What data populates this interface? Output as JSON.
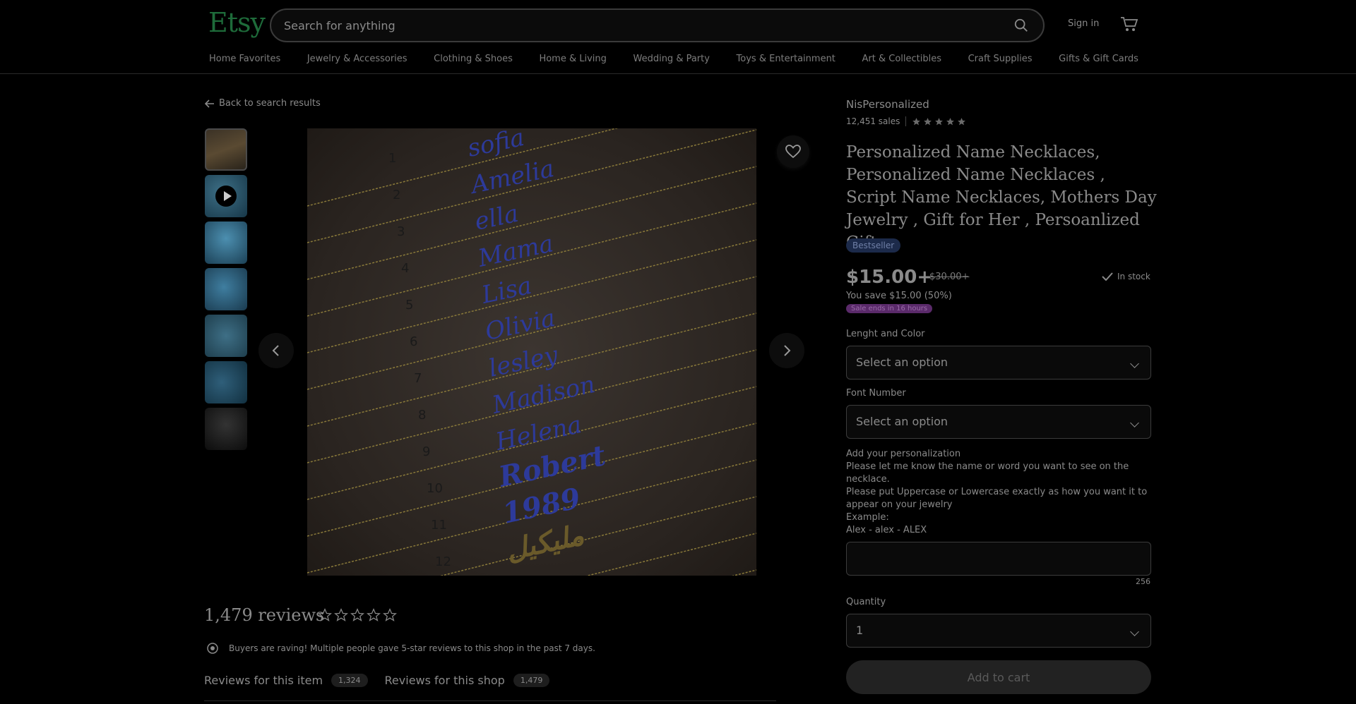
{
  "header": {
    "logo": "Etsy",
    "search_placeholder": "Search for anything",
    "sign_in": "Sign in"
  },
  "nav": [
    "Home Favorites",
    "Jewelry & Accessories",
    "Clothing & Shoes",
    "Home & Living",
    "Wedding & Party",
    "Toys & Entertainment",
    "Art & Collectibles",
    "Craft Supplies",
    "Gifts & Gift Cards"
  ],
  "back_link": "Back to search results",
  "gallery": {
    "numbers": [
      "1",
      "2",
      "3",
      "4",
      "5",
      "6",
      "7",
      "8",
      "9",
      "10",
      "11",
      "12"
    ],
    "names": [
      "sofia",
      "Amelia",
      "ella",
      "Mama",
      "Lisa",
      "Olivia",
      "lesley",
      "Madison",
      "Helena",
      "Robert",
      "1989",
      "مليكيل"
    ]
  },
  "reviews": {
    "title": "1,479 reviews",
    "raving": "Buyers are raving! Multiple people gave 5-star reviews to this shop in the past 7 days.",
    "tab_item": "Reviews for this item",
    "tab_item_count": "1,324",
    "tab_shop": "Reviews for this shop",
    "tab_shop_count": "1,479"
  },
  "product": {
    "shop": "NisPersonalized",
    "sales": "12,451 sales",
    "title": "Personalized Name Necklaces, Personalized Name Necklaces , Script Name Necklaces, Mothers Day Jewelry , Gift for Her , Persoanlized Gift",
    "badge": "Bestseller",
    "price": "$15.00+",
    "original_price": "$30.00+",
    "stock": "In stock",
    "save": "You save $15.00 (50%)",
    "sale_pill": "Sale ends in 16 hours",
    "length_label": "Lenght and Color",
    "length_value": "Select an option",
    "font_label": "Font Number",
    "font_value": "Select an option",
    "personalization_label": "Add your personalization",
    "personalization_lines": [
      "Please let me know the name or word you want to see on the necklace.",
      "Please put Uppercase or Lowercase exactly as how you want it to appear on your jewelry",
      "Example:",
      "Alex - alex - ALEX"
    ],
    "char_count": "256",
    "quantity_label": "Quantity",
    "quantity_value": "1",
    "add_to_cart": "Add to cart"
  },
  "colors": {
    "accent": "#1e6b3a",
    "name_blue": "#2d3a9a",
    "chain_gold": "#8a7a3a",
    "badge_bg": "#1c2a4a",
    "sale_bg": "#5a2a6a"
  }
}
